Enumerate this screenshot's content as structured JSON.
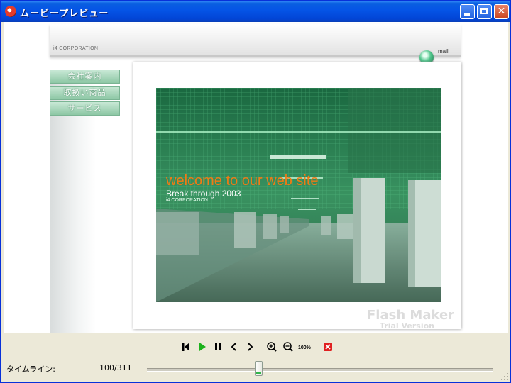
{
  "window": {
    "title": "ムービープレビュー"
  },
  "header": {
    "corp_name": "i4 CORPORATION",
    "mail_label": "mail"
  },
  "menu": {
    "items": [
      {
        "label": "会社案内"
      },
      {
        "label": "取扱い商品"
      },
      {
        "label": "サービス"
      }
    ]
  },
  "banner": {
    "headline": "welcome to our web site",
    "tagline": "Break through  2003",
    "corp_name": "i4 CORPORATION"
  },
  "watermark": {
    "line1": "Flash Maker",
    "line2": "Trial Version"
  },
  "controls": {
    "icons": [
      "rewind-to-start-icon",
      "play-icon",
      "pause-icon",
      "step-back-icon",
      "step-forward-icon",
      "zoom-in-icon",
      "zoom-out-icon",
      "zoom-100-icon",
      "close-red-icon"
    ],
    "zoom_label": "100%"
  },
  "timeline": {
    "label": "タイムライン:",
    "frame_text": "100/311",
    "current_frame": 100,
    "total_frames": 311
  },
  "colors": {
    "accent": "#0245d6",
    "headline": "#f07a14",
    "menu_green": "#8dc7a5",
    "close_red": "#e02020",
    "play_green": "#1cb21c"
  }
}
